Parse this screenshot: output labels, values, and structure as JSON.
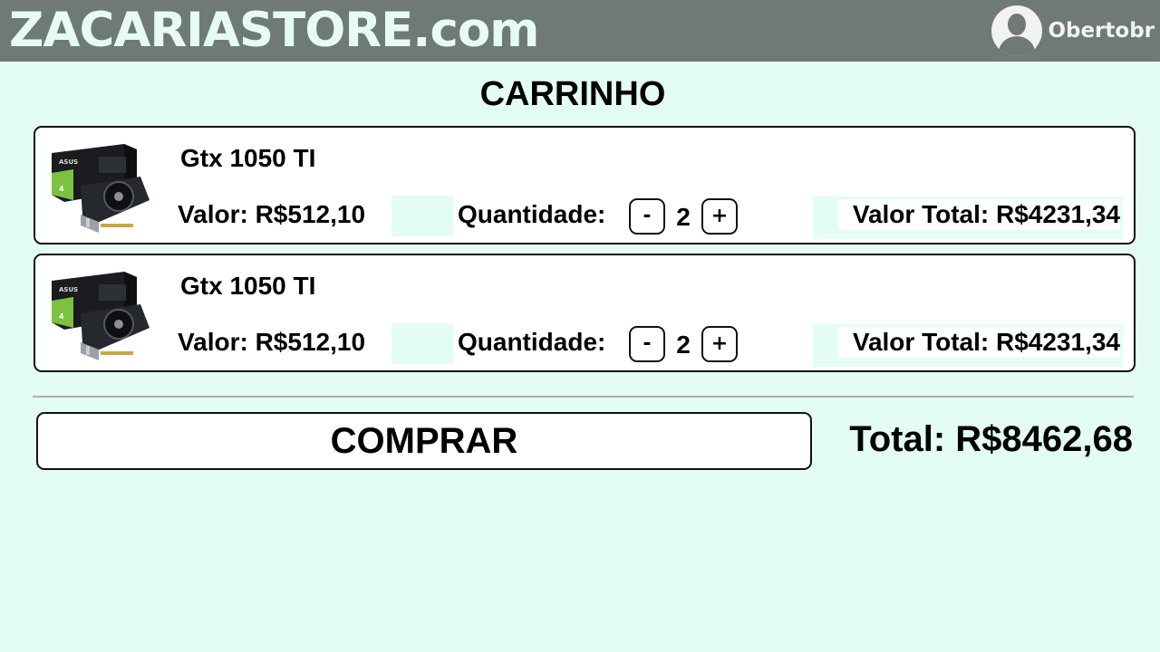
{
  "header": {
    "brand": "ZACARIASTORE.com",
    "username": "Obertobr",
    "avatar_icon": "user-avatar-icon",
    "bar_color": "#6e7a73"
  },
  "page": {
    "title": "CARRINHO",
    "background": "#e3fdf3"
  },
  "cart": {
    "items": [
      {
        "name": "Gtx 1050 TI",
        "image_icon": "graphics-card-image",
        "price": "Valor: R$512,10",
        "quantity_label": "Quantidade:",
        "decrement_label": "-",
        "quantity": "2",
        "increment_label": "+",
        "line_total": "Valor Total: R$4231,34"
      },
      {
        "name": "Gtx 1050 TI",
        "image_icon": "graphics-card-image",
        "price": "Valor: R$512,10",
        "quantity_label": "Quantidade:",
        "decrement_label": "-",
        "quantity": "2",
        "increment_label": "+",
        "line_total": "Valor Total: R$4231,34"
      }
    ]
  },
  "checkout": {
    "buy_label": "COMPRAR",
    "grand_total": "Total: R$8462,68"
  }
}
